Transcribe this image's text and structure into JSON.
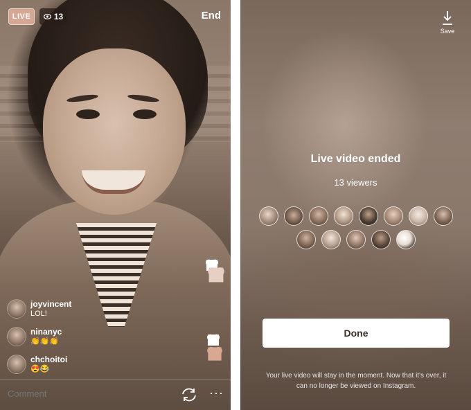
{
  "live": {
    "badge": "LIVE",
    "viewer_count": "13",
    "end_label": "End",
    "comment_placeholder": "Comment",
    "more_label": "···",
    "comments": [
      {
        "user": "joyvincent",
        "message": "LOL!"
      },
      {
        "user": "ninanyc",
        "message": "👏👏👏"
      },
      {
        "user": "chchoitoi",
        "message": "😍😂"
      }
    ],
    "heart_colors": [
      "#ffffff",
      "#e8cfc3",
      "#ffffff",
      "#d9a892"
    ]
  },
  "ended": {
    "save_label": "Save",
    "title": "Live video ended",
    "viewers": "13 viewers",
    "viewer_avatar_count": 13,
    "done_label": "Done",
    "note": "Your live video will stay in the moment. Now that it's over, it can no longer be viewed on Instagram."
  },
  "colors": {
    "live_badge": "#d6a794",
    "photo_tint": "#8f7d70",
    "button_text": "#3b2f27"
  },
  "icons": [
    "eye-icon",
    "camera-flip-icon",
    "more-icon",
    "download-icon",
    "heart-icon"
  ]
}
